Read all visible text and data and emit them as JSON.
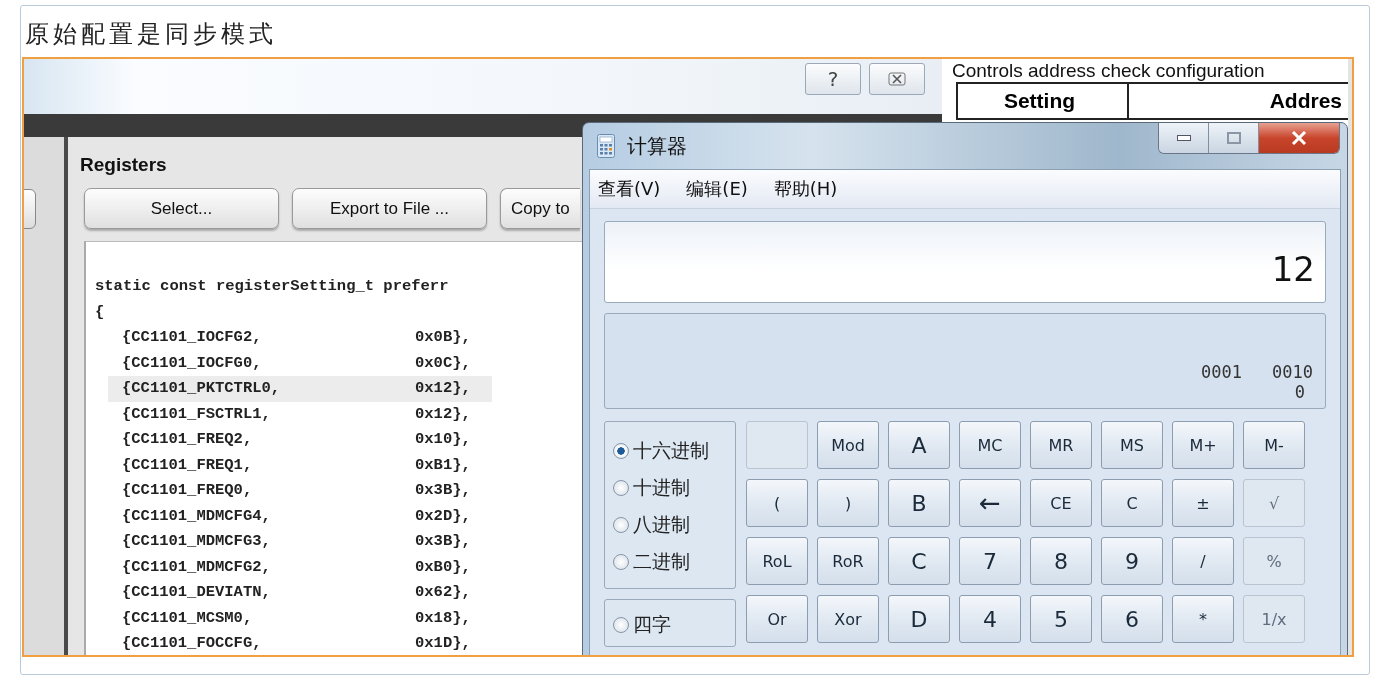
{
  "caption": "原始配置是同步模式",
  "studio": {
    "help_button": "?",
    "registers": {
      "title": "Registers",
      "buttons": [
        "Select...",
        "Export to File ...",
        "Copy to"
      ]
    },
    "code": {
      "header": "static const registerSetting_t preferr",
      "open_brace": "{",
      "entries": [
        {
          "name": "{CC1101_IOCFG2,",
          "value": "0x0B},",
          "selected": false
        },
        {
          "name": "{CC1101_IOCFG0,",
          "value": "0x0C},",
          "selected": false
        },
        {
          "name": "{CC1101_PKTCTRL0,",
          "value": "0x12},",
          "selected": true
        },
        {
          "name": "{CC1101_FSCTRL1,",
          "value": "0x12},",
          "selected": false
        },
        {
          "name": "{CC1101_FREQ2,",
          "value": "0x10},",
          "selected": false
        },
        {
          "name": "{CC1101_FREQ1,",
          "value": "0xB1},",
          "selected": false
        },
        {
          "name": "{CC1101_FREQ0,",
          "value": "0x3B},",
          "selected": false
        },
        {
          "name": "{CC1101_MDMCFG4,",
          "value": "0x2D},",
          "selected": false
        },
        {
          "name": "{CC1101_MDMCFG3,",
          "value": "0x3B},",
          "selected": false
        },
        {
          "name": "{CC1101_MDMCFG2,",
          "value": "0xB0},",
          "selected": false
        },
        {
          "name": "{CC1101_DEVIATN,",
          "value": "0x62},",
          "selected": false
        },
        {
          "name": "{CC1101_MCSM0,",
          "value": "0x18},",
          "selected": false
        },
        {
          "name": "{CC1101_FOCCFG,",
          "value": "0x1D},",
          "selected": false
        }
      ]
    }
  },
  "document": {
    "caption": "Controls address check configuration",
    "columns": [
      "Setting",
      "Addres"
    ]
  },
  "calculator": {
    "title": "计算器",
    "menu": [
      "查看(V)",
      "编辑(E)",
      "帮助(H)"
    ],
    "display": "12",
    "binary_groups": [
      "0001",
      "0010"
    ],
    "bit_index": "0",
    "radix": [
      {
        "label": "十六进制",
        "selected": true
      },
      {
        "label": "十进制",
        "selected": false
      },
      {
        "label": "八进制",
        "selected": false
      },
      {
        "label": "二进制",
        "selected": false
      }
    ],
    "word_size": [
      {
        "label": "四字",
        "selected": false
      }
    ],
    "keys": [
      [
        {
          "kind": "function",
          "disabled": true
        },
        {
          "label": "Mod",
          "kind": "function",
          "disabled": false
        },
        {
          "label": "A",
          "kind": "digit",
          "disabled": false
        },
        {
          "label": "MC",
          "kind": "function",
          "disabled": false
        },
        {
          "label": "MR",
          "kind": "function",
          "disabled": false
        },
        {
          "label": "MS",
          "kind": "function",
          "disabled": false
        },
        {
          "label": "M+",
          "kind": "function",
          "disabled": false
        },
        {
          "label": "M-",
          "kind": "function",
          "disabled": false
        }
      ],
      [
        {
          "label": "(",
          "kind": "function",
          "disabled": false
        },
        {
          "label": ")",
          "kind": "function",
          "disabled": false
        },
        {
          "label": "B",
          "kind": "digit",
          "disabled": false
        },
        {
          "label": "←",
          "kind": "arrow",
          "disabled": false
        },
        {
          "label": "CE",
          "kind": "function",
          "disabled": false
        },
        {
          "label": "C",
          "kind": "function",
          "disabled": false
        },
        {
          "label": "±",
          "kind": "function",
          "disabled": false
        },
        {
          "label": "√",
          "kind": "function",
          "disabled": true
        }
      ],
      [
        {
          "label": "RoL",
          "kind": "function",
          "disabled": false
        },
        {
          "label": "RoR",
          "kind": "function",
          "disabled": false
        },
        {
          "label": "C",
          "kind": "digit",
          "disabled": false
        },
        {
          "label": "7",
          "kind": "digit",
          "disabled": false
        },
        {
          "label": "8",
          "kind": "digit",
          "disabled": false
        },
        {
          "label": "9",
          "kind": "digit",
          "disabled": false
        },
        {
          "label": "/",
          "kind": "function",
          "disabled": false
        },
        {
          "label": "%",
          "kind": "function",
          "disabled": true
        }
      ],
      [
        {
          "label": "Or",
          "kind": "function",
          "disabled": false
        },
        {
          "label": "Xor",
          "kind": "function",
          "disabled": false
        },
        {
          "label": "D",
          "kind": "digit",
          "disabled": false
        },
        {
          "label": "4",
          "kind": "digit",
          "disabled": false
        },
        {
          "label": "5",
          "kind": "digit",
          "disabled": false
        },
        {
          "label": "6",
          "kind": "digit",
          "disabled": false
        },
        {
          "label": "*",
          "kind": "function",
          "disabled": false
        },
        {
          "label": "1/x",
          "kind": "function",
          "disabled": true
        }
      ]
    ]
  }
}
